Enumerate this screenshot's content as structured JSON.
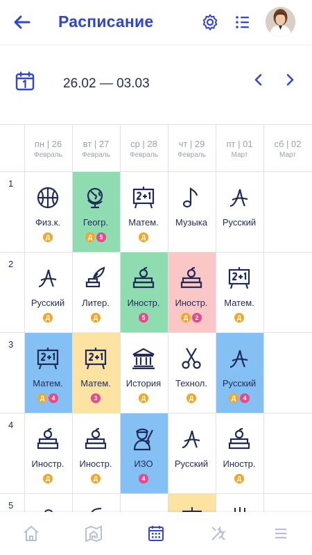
{
  "header": {
    "title": "Расписание"
  },
  "week": {
    "range": "26.02 — 03.03"
  },
  "days": [
    {
      "label": "пн | 26",
      "month": "Февраль"
    },
    {
      "label": "вт | 27",
      "month": "Февраль"
    },
    {
      "label": "ср | 28",
      "month": "Февраль"
    },
    {
      "label": "чт | 29",
      "month": "Февраль"
    },
    {
      "label": "пт | 01",
      "month": "Март"
    },
    {
      "label": "сб | 02",
      "month": "Март"
    }
  ],
  "rows": [
    "1",
    "2",
    "3",
    "4",
    "5"
  ],
  "badges": {
    "d": "Д"
  },
  "lessons": {
    "r1": [
      {
        "name": "Физ.к.",
        "mark": ""
      },
      {
        "name": "Геогр.",
        "mark": "5"
      },
      {
        "name": "Матем.",
        "mark": ""
      },
      {
        "name": "Музыка",
        "mark": ""
      },
      {
        "name": "Русский",
        "mark": ""
      }
    ],
    "r2": [
      {
        "name": "Русский",
        "mark": ""
      },
      {
        "name": "Литер.",
        "mark": ""
      },
      {
        "name": "Иностр.",
        "mark": "5"
      },
      {
        "name": "Иностр.",
        "mark": "2"
      },
      {
        "name": "Матем.",
        "mark": ""
      }
    ],
    "r3": [
      {
        "name": "Матем.",
        "mark": "4"
      },
      {
        "name": "Матем.",
        "mark": "3"
      },
      {
        "name": "История",
        "mark": ""
      },
      {
        "name": "Технол.",
        "mark": ""
      },
      {
        "name": "Русский",
        "mark": "4"
      }
    ],
    "r4": [
      {
        "name": "Иностр.",
        "mark": ""
      },
      {
        "name": "Иностр.",
        "mark": ""
      },
      {
        "name": "ИЗО",
        "mark": "4"
      },
      {
        "name": "Русский",
        "mark": ""
      },
      {
        "name": "Иностр.",
        "mark": ""
      }
    ]
  },
  "colors": {
    "accent": "#2f45d8",
    "green": "#8fdcb0",
    "pink": "#fbc6c6",
    "blue": "#84c0f4",
    "yellow": "#fde3a2",
    "badge_d": "#f5a623",
    "badge_mark": "#e64a8a"
  }
}
